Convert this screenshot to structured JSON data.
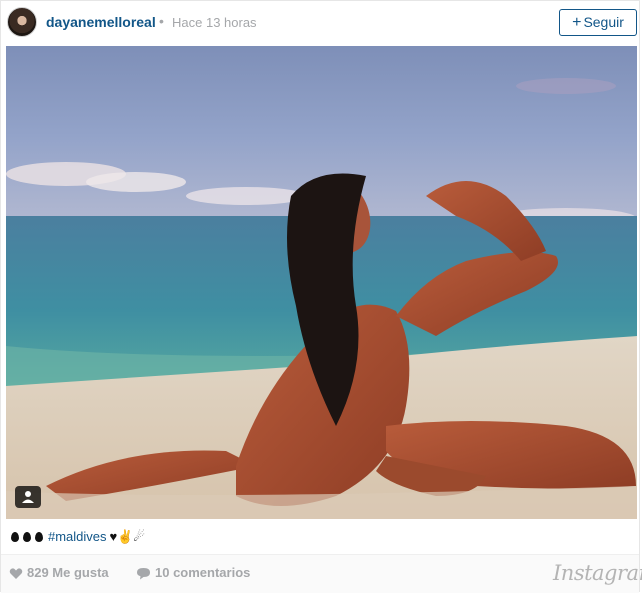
{
  "header": {
    "username": "dayanemelloreal",
    "separator": "•",
    "timestamp": "Hace 13 horas",
    "follow_label": "Seguir",
    "follow_plus": "+"
  },
  "photo": {
    "alt": "Photo of a woman posing on a sandy beach with ocean and sky"
  },
  "caption": {
    "hashtag": "#maldives",
    "trailing_emoji": "♥✌☄"
  },
  "footer": {
    "likes_text": "829 Me gusta",
    "comments_text": "10 comentarios",
    "brand": "Instagram"
  },
  "colors": {
    "link": "#125688",
    "muted": "#a5a7aa"
  }
}
